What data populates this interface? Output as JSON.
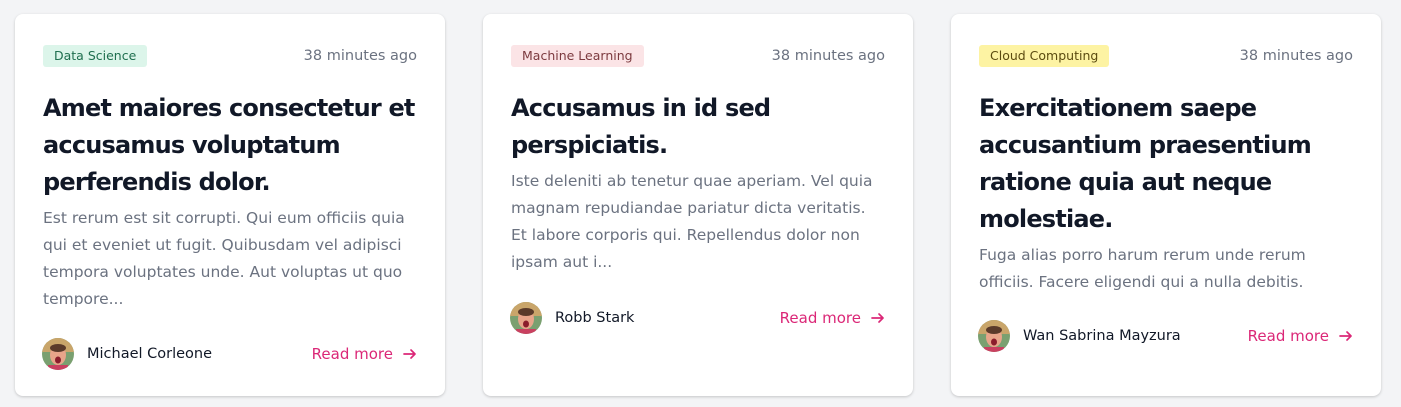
{
  "colors": {
    "accent": "#db2777",
    "badge_green": "#dcf5ea",
    "badge_red": "#fbe4e6",
    "badge_yellow": "#fdf3a3"
  },
  "cards": [
    {
      "category": "Data Science",
      "time": "38 minutes ago",
      "title": "Amet maiores consectetur et accusamus voluptatum perferendis dolor.",
      "excerpt": "Est rerum est sit corrupti. Qui eum officiis quia qui et eveniet ut fugit. Quibusdam vel adipisci tempora voluptates unde. Aut voluptas ut quo tempore...",
      "author": "Michael Corleone",
      "read_more": "Read more",
      "avatar_icon": "user-avatar-icon",
      "arrow_icon": "arrow-right-icon"
    },
    {
      "category": "Machine Learning",
      "time": "38 minutes ago",
      "title": "Accusamus in id sed perspiciatis.",
      "excerpt": "Iste deleniti ab tenetur quae aperiam. Vel quia magnam repudiandae pariatur dicta veritatis. Et labore corporis qui. Repellendus dolor non ipsam aut i...",
      "author": "Robb Stark",
      "read_more": "Read more",
      "avatar_icon": "user-avatar-icon",
      "arrow_icon": "arrow-right-icon"
    },
    {
      "category": "Cloud Computing",
      "time": "38 minutes ago",
      "title": "Exercitationem saepe accusantium praesentium ratione quia aut neque molestiae.",
      "excerpt": "Fuga alias porro harum rerum unde rerum officiis. Facere eligendi qui a nulla debitis.",
      "author": "Wan Sabrina Mayzura",
      "read_more": "Read more",
      "avatar_icon": "user-avatar-icon",
      "arrow_icon": "arrow-right-icon"
    }
  ]
}
